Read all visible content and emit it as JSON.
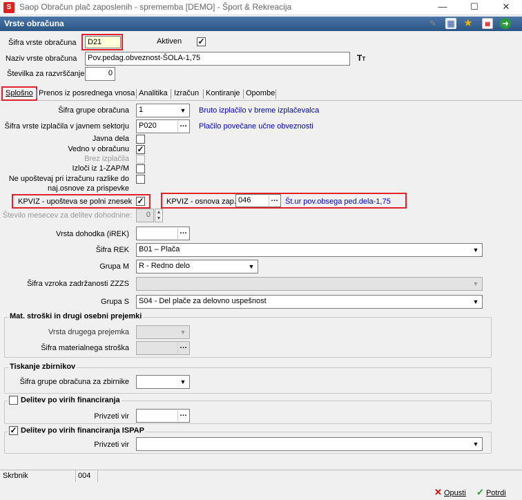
{
  "window": {
    "title": "Saop Obračun plač zaposlenih - sprememba [DEMO] - Šport & Rekreacija",
    "minimize": "—",
    "maximize": "☐",
    "close": "✕",
    "app_icon": "S"
  },
  "form": {
    "title": "Vrste obračuna"
  },
  "toolbar": {
    "icons": [
      "edit-icon",
      "calendar-icon",
      "star-icon",
      "pdf-icon",
      "export-icon"
    ]
  },
  "top": {
    "sifra_label": "Šifra vrste obračuna",
    "sifra_value": "D21",
    "aktiven_label": "Aktiven",
    "aktiven_checked": true,
    "naziv_label": "Naziv vrste obračuna",
    "naziv_value": "Pov.pedag.obveznost-ŠOLA-1,75",
    "stevilka_label": "Številka  za razvrščanje",
    "stevilka_value": "0"
  },
  "tabs": [
    "Splošno",
    "Prenos iz posrednega vnosa",
    "Analitika",
    "Izračun",
    "Kontiranje",
    "Opombe"
  ],
  "splosno": {
    "grupa_label": "Šifra grupe obračuna",
    "grupa_value": "1",
    "grupa_desc": "Bruto izplačilo v breme izplačevalca",
    "izplacila_label": "Šifra vrste izplačila v javnem sektorju",
    "izplacila_value": "P020",
    "izplacila_desc": "Plačilo povečane učne obveznosti",
    "javna_dela_label": "Javna dela",
    "javna_dela": false,
    "vedno_label": "Vedno v obračunu",
    "vedno": true,
    "brez_label": "Brez izplačila",
    "brez": false,
    "izloci_label": "Izloči iz 1-ZAP/M",
    "izloci": false,
    "neupostevaj_label_1": "Ne upoštevaj pri izračunu razlike do",
    "neupostevaj_label_2": "naj.osnove za prispevke",
    "neupostevaj": false,
    "kpviz_label": "KPVIZ - upošteva se polni znesek",
    "kpviz": true,
    "kpviz_osnova_label": "KPVIZ - osnova zap.",
    "kpviz_osnova_value": "046",
    "kpviz_osnova_desc": "Št.ur pov.obsega ped.dela-1,75",
    "stevilo_mesecev_label": "Število mesecev za delitev dohodnine:",
    "stevilo_mesecev_value": "0",
    "vrsta_dohodka_label": "Vrsta dohodka (iREK)",
    "vrsta_dohodka_value": "",
    "sifra_rek_label": "Šifra REK",
    "sifra_rek_value": "B01 – Plača",
    "grupa_m_label": "Grupa M",
    "grupa_m_value": "R - Redno delo",
    "zzzs_label": "Šifra vzroka zadržanosti ZZZS",
    "zzzs_value": "",
    "grupa_s_label": "Grupa S",
    "grupa_s_value": "S04 - Del plače za delovno uspešnost"
  },
  "mat": {
    "title": "Mat. stroški in drugi osebni prejemki",
    "vrsta_label": "Vrsta drugega prejemka",
    "vrsta_value": "",
    "sifra_label": "Šifra materialnega stroška",
    "sifra_value": ""
  },
  "tisk": {
    "title": "Tiskanje zbirnikov",
    "label": "Šifra grupe obračuna za zbirnike",
    "value": ""
  },
  "delitev": {
    "title": "Delitev po virih financiranja",
    "checked": false,
    "vir_label": "Privzeti vir",
    "vir_value": ""
  },
  "delitev_ispap": {
    "title": "Delitev po virih financiranja ISPAP",
    "checked": true,
    "vir_label": "Privzeti vir",
    "vir_value": ""
  },
  "status": {
    "skrbnik_label": "Skrbnik",
    "skrbnik_value": "004"
  },
  "buttons": {
    "opusti": "Opusti",
    "potrdi": "Potrdi"
  }
}
